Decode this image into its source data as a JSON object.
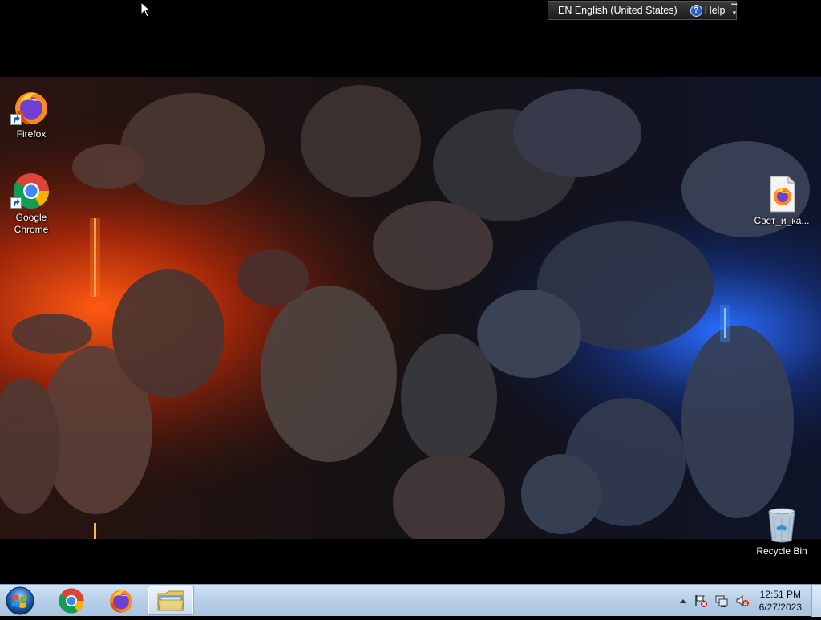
{
  "language_bar": {
    "language": "EN English (United States)",
    "help_label": "Help",
    "help_symbol": "?"
  },
  "desktop_icons": [
    {
      "label": "Firefox",
      "icon": "firefox-icon",
      "shortcut": true
    },
    {
      "label": "Google Chrome",
      "icon": "chrome-icon",
      "shortcut": true
    },
    {
      "label": "Свет_и_ка...",
      "icon": "firefox-document-icon",
      "shortcut": false
    },
    {
      "label": "Recycle Bin",
      "icon": "recycle-bin-icon",
      "shortcut": false
    }
  ],
  "taskbar": {
    "pinned": [
      {
        "name": "chrome",
        "icon": "chrome-icon"
      },
      {
        "name": "firefox",
        "icon": "firefox-icon"
      },
      {
        "name": "explorer",
        "icon": "folder-icon",
        "active": true
      }
    ],
    "tray_icons": [
      "show-hidden-icons-arrow",
      "action-center-flag-icon",
      "network-icon",
      "volume-muted-icon"
    ],
    "clock": {
      "time": "12:51 PM",
      "date": "6/27/2023"
    }
  },
  "colors": {
    "wallpaper_warm": "#ff4a10",
    "wallpaper_cool": "#1a4cff",
    "taskbar": "#b9d1ea"
  }
}
